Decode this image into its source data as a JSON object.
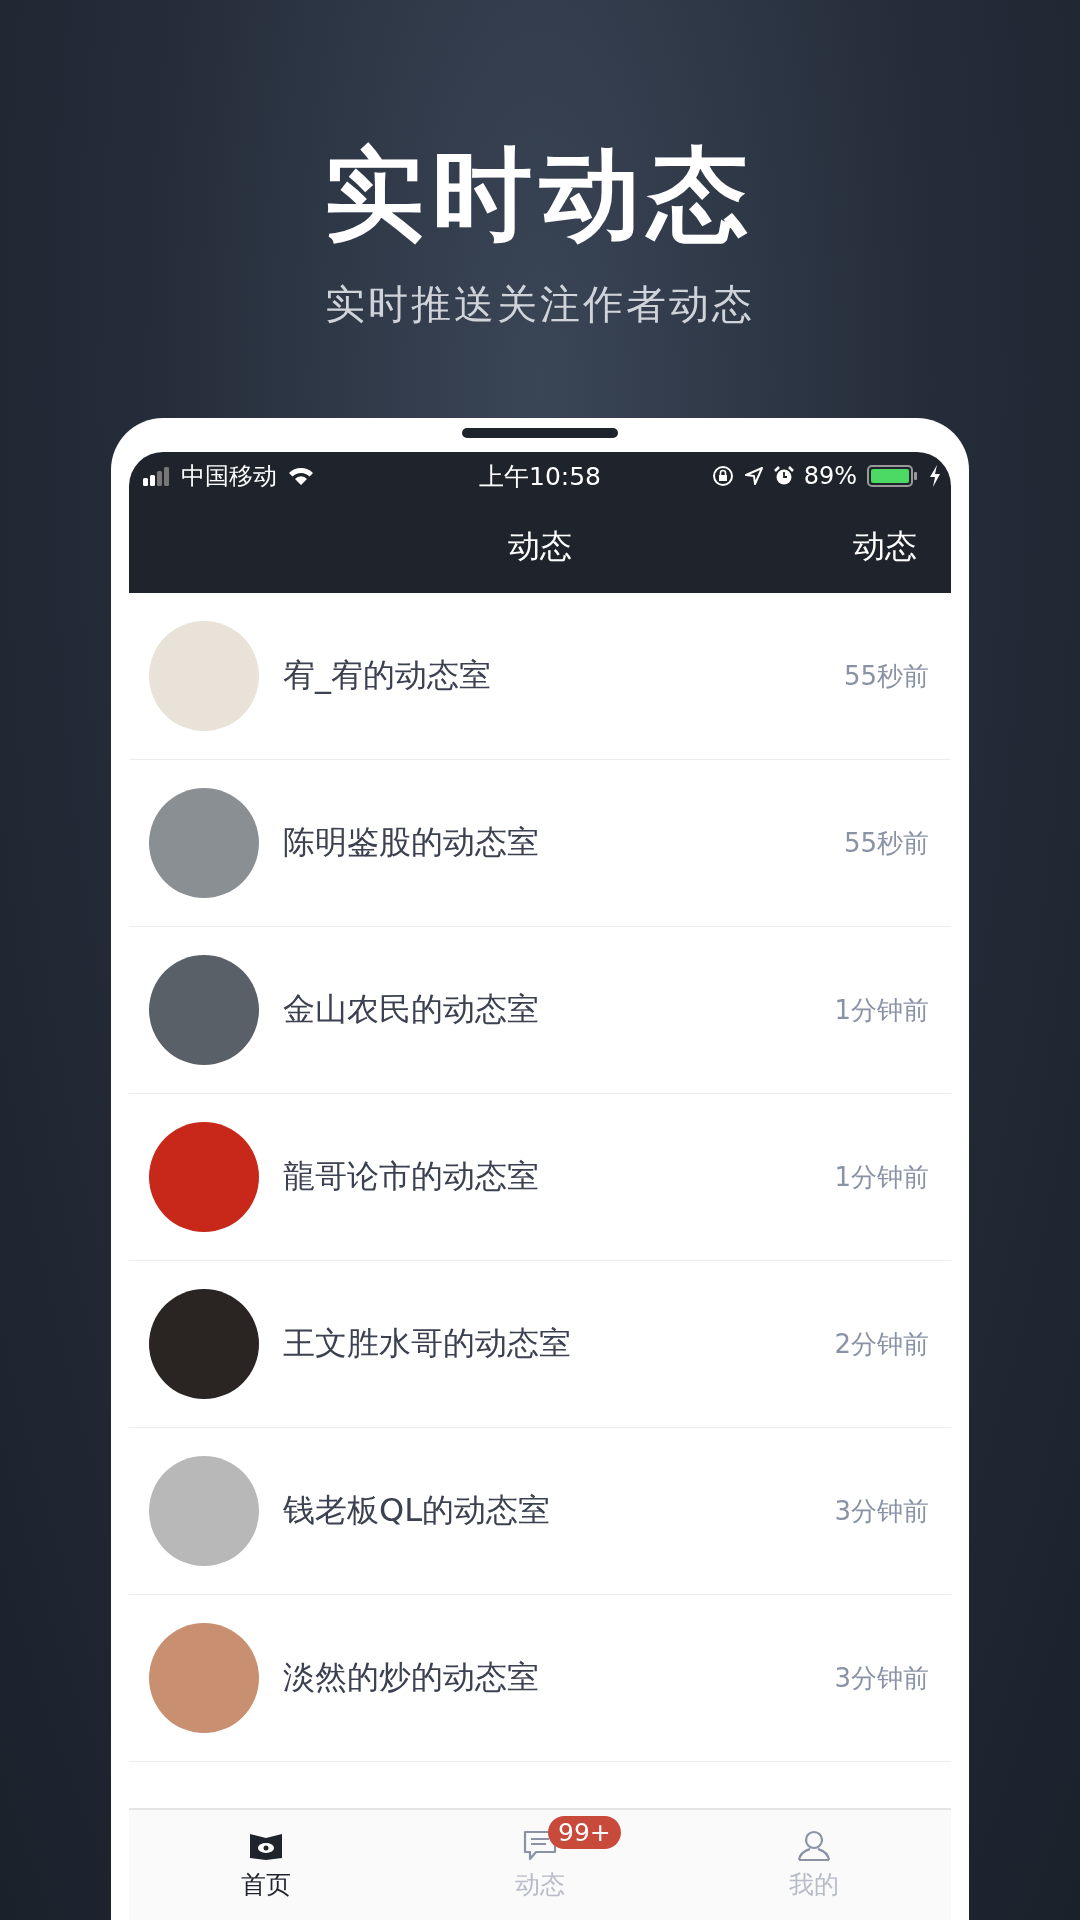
{
  "hero": {
    "title": "实时动态",
    "subtitle": "实时推送关注作者动态"
  },
  "status_bar": {
    "carrier": "中国移动",
    "time": "上午10:58",
    "battery": "89%"
  },
  "nav_bar": {
    "title": "动态",
    "action": "动态"
  },
  "rooms": [
    {
      "name": "宥_宥的动态室",
      "time": "55秒前"
    },
    {
      "name": "陈明鉴股的动态室",
      "time": "55秒前"
    },
    {
      "name": "金山农民的动态室",
      "time": "1分钟前"
    },
    {
      "name": "龍哥论市的动态室",
      "time": "1分钟前"
    },
    {
      "name": "王文胜水哥的动态室",
      "time": "2分钟前"
    },
    {
      "name": "钱老板QL的动态室",
      "time": "3分钟前"
    },
    {
      "name": "淡然的炒的动态室",
      "time": "3分钟前"
    }
  ],
  "tab_bar": [
    {
      "kind": "home",
      "label": "首页",
      "selected": true
    },
    {
      "kind": "messages",
      "label": "动态",
      "selected": false,
      "badge": "99+"
    },
    {
      "kind": "profile",
      "label": "我的",
      "selected": false
    }
  ]
}
